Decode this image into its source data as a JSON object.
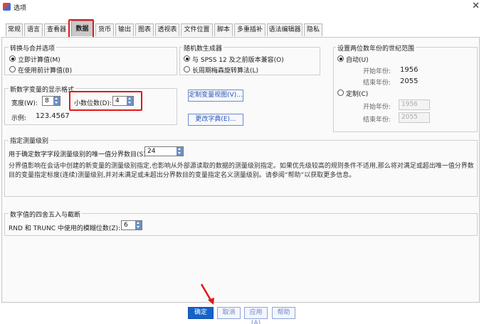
{
  "window": {
    "title": "选项",
    "close_glyph": "✕"
  },
  "tabs": [
    "常规",
    "语言",
    "查看器",
    "数据",
    "货币",
    "输出",
    "图表",
    "透视表",
    "文件位置",
    "脚本",
    "多重插补",
    "语法编辑器",
    "隐私"
  ],
  "active_tab": "数据",
  "transform": {
    "title": "转换与合并选项",
    "options": [
      "立即计算值(M)",
      "在使用前计算值(B)"
    ]
  },
  "random": {
    "title": "随机数生成器",
    "options": [
      "与 SPSS 12 及之前版本兼容(O)",
      "长周期梅森旋转算法(L)"
    ]
  },
  "century": {
    "title": "设置两位数年份的世纪范围",
    "auto_label": "自动(U)",
    "custom_label": "定制(C)",
    "start_label": "开始年份:",
    "end_label": "结束年份:",
    "auto_start": "1956",
    "auto_end": "2055",
    "custom_start": "1956",
    "custom_end": "2055"
  },
  "numeric_format": {
    "title": "新数字变量的显示格式",
    "width_label": "宽度(W):",
    "width_value": "8",
    "decimals_label": "小数位数(D):",
    "decimals_value": "4",
    "sample_label": "示例:",
    "sample_value": "123.4567"
  },
  "buttons_mid": {
    "custom_view": "定制变量视图(V)...",
    "change_dict": "更改字典(E)..."
  },
  "measurement": {
    "title": "指定测量级别",
    "threshold_label": "用于确定数字字段测量级别的唯一值分界数目(S)",
    "threshold_value": "24",
    "description": "分界值影响在会话中创建的新变量的测量级别指定,也影响从外部源读取的数据的测量级别指定。如果优先级较高的规则条件不适用,那么将对满足或超出唯一值分界数目的变量指定标度(连续)测量级别,并对未满足或未超出分界数目的变量指定名义测量级别。请参阅“帮助”以获取更多信息。"
  },
  "rounding": {
    "title": "数字值的四舍五入与截断",
    "label": "RND 和 TRUNC 中使用的模糊位数(Z):",
    "value": "6"
  },
  "footer": {
    "ok": "确定",
    "cancel": "取消",
    "apply": "应用(A)",
    "help": "帮助"
  },
  "colors": {
    "primary": "#1463c9",
    "highlight": "#e01818",
    "link": "#2b53b8"
  }
}
